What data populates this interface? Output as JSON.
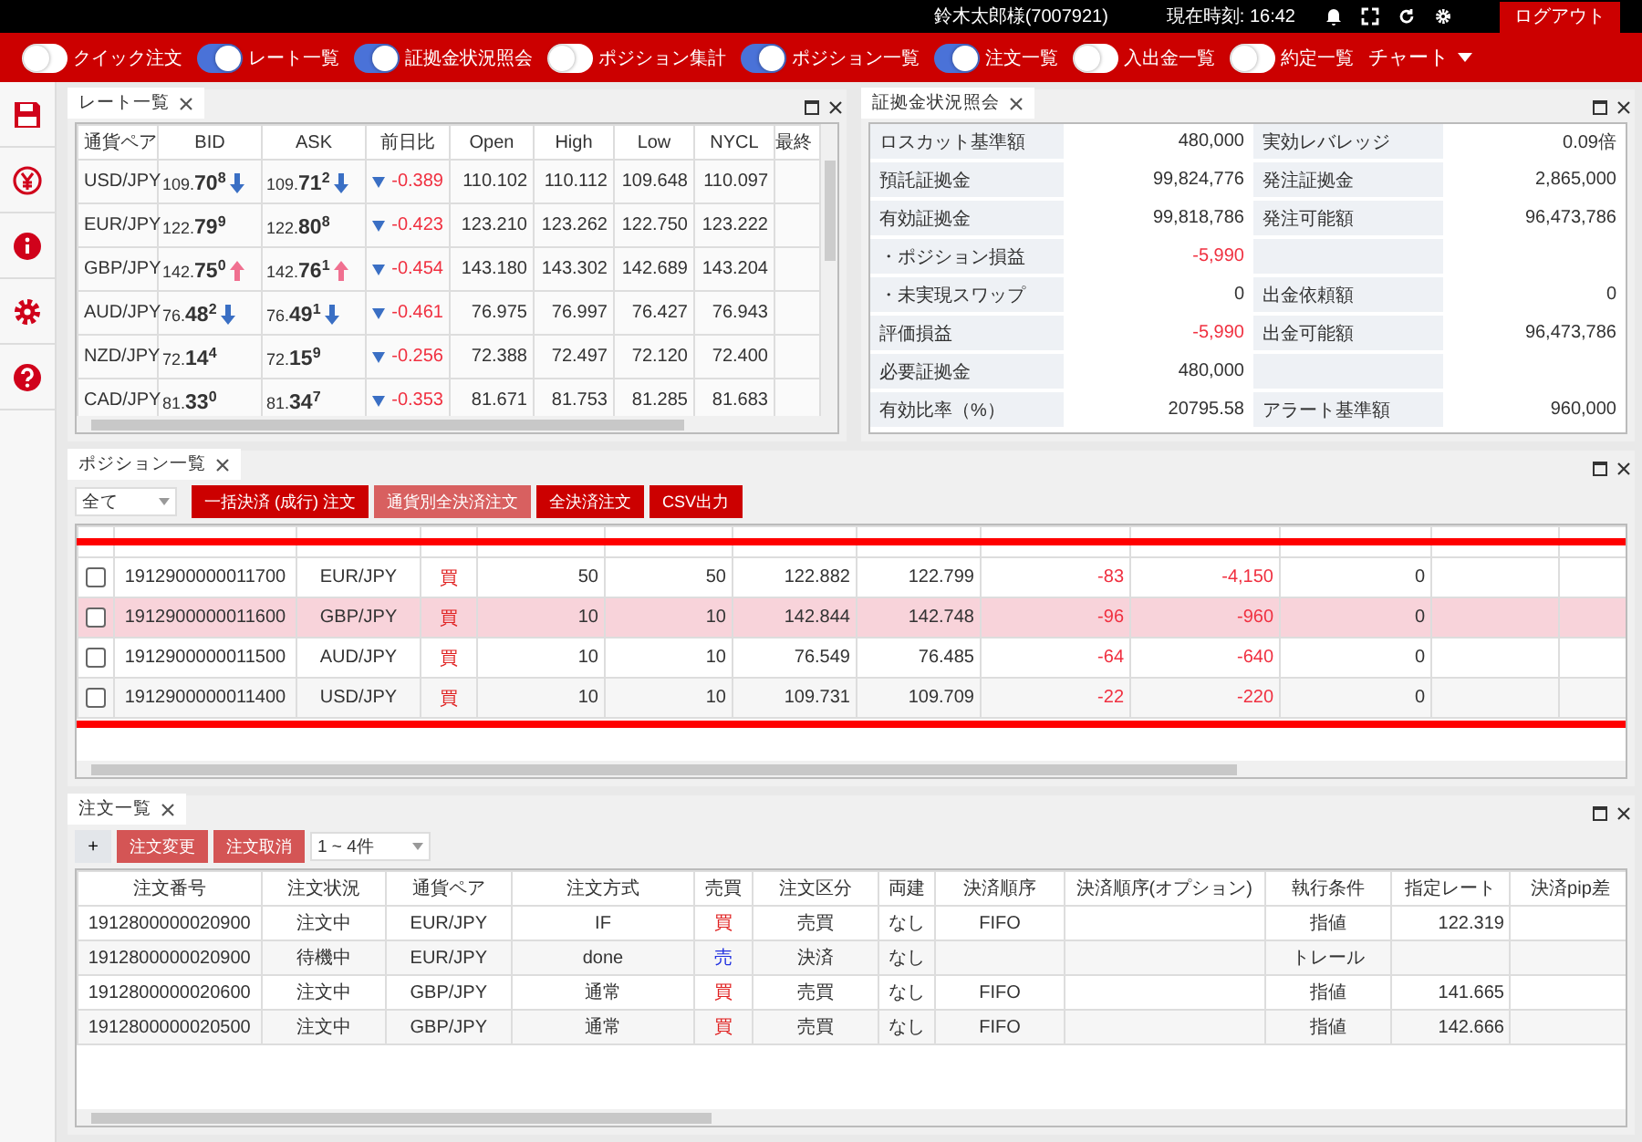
{
  "header": {
    "user": "鈴木太郎様(7007921)",
    "clock_label": "現在時刻:",
    "clock": "16:42",
    "logout": "ログアウト"
  },
  "toolbar": {
    "toggles": [
      {
        "label": "クイック注文",
        "on": false
      },
      {
        "label": "レート一覧",
        "on": true
      },
      {
        "label": "証拠金状況照会",
        "on": true
      },
      {
        "label": "ポジション集計",
        "on": false
      },
      {
        "label": "ポジション一覧",
        "on": true
      },
      {
        "label": "注文一覧",
        "on": true
      },
      {
        "label": "入出金一覧",
        "on": false
      },
      {
        "label": "約定一覧",
        "on": false
      }
    ],
    "chart_menu": "チャート"
  },
  "rate_panel": {
    "title": "レート一覧",
    "columns": [
      "通貨ペア",
      "BID",
      "ASK",
      "前日比",
      "Open",
      "High",
      "Low",
      "NYCL",
      "最終"
    ],
    "rows": [
      {
        "pair": "USD/JPY",
        "bid": "109.**70**$^{8}$",
        "bid_up": false,
        "bid_down": true,
        "ask": "109.**71**$^{2}$",
        "ask_up": false,
        "ask_down": true,
        "change_down": true,
        "change": "-0.389",
        "open": "110.102",
        "high": "110.112",
        "low": "109.648",
        "nycl": "110.097"
      },
      {
        "pair": "EUR/JPY",
        "bid": "122.**79**$^{9}$",
        "bid_up": false,
        "bid_down": false,
        "ask": "122.**80**$^{8}$",
        "ask_up": false,
        "ask_down": false,
        "change_down": true,
        "change": "-0.423",
        "open": "123.210",
        "high": "123.262",
        "low": "122.750",
        "nycl": "123.222"
      },
      {
        "pair": "GBP/JPY",
        "bid": "142.**75**$^{0}$",
        "bid_up": true,
        "bid_down": false,
        "ask": "142.**76**$^{1}$",
        "ask_up": true,
        "ask_down": false,
        "change_down": true,
        "change": "-0.454",
        "open": "143.180",
        "high": "143.302",
        "low": "142.689",
        "nycl": "143.204"
      },
      {
        "pair": "AUD/JPY",
        "bid": "76.**48**$^{2}$",
        "bid_up": false,
        "bid_down": true,
        "ask": "76.**49**$^{1}$",
        "ask_up": false,
        "ask_down": true,
        "change_down": true,
        "change": "-0.461",
        "open": "76.975",
        "high": "76.997",
        "low": "76.427",
        "nycl": "76.943"
      },
      {
        "pair": "NZD/JPY",
        "bid": "72.**14**$^{4}$",
        "bid_up": false,
        "bid_down": false,
        "ask": "72.**15**$^{9}$",
        "ask_up": false,
        "ask_down": false,
        "change_down": true,
        "change": "-0.256",
        "open": "72.388",
        "high": "72.497",
        "low": "72.120",
        "nycl": "72.400"
      },
      {
        "pair": "CAD/JPY",
        "bid": "81.**33**$^{0}$",
        "bid_up": false,
        "bid_down": false,
        "ask": "81.**34**$^{7}$",
        "ask_up": false,
        "ask_down": false,
        "change_down": true,
        "change": "-0.353",
        "open": "81.671",
        "high": "81.753",
        "low": "81.285",
        "nycl": "81.683"
      }
    ]
  },
  "margin_panel": {
    "title": "証拠金状況照会",
    "rows": [
      {
        "label": "ロスカット基準額",
        "value": "480,000",
        "negative": false,
        "label2": "実効レバレッジ",
        "value2": "0.09倍"
      },
      {
        "label": "預託証拠金",
        "value": "99,824,776",
        "negative": false,
        "label2": "発注証拠金",
        "value2": "2,865,000"
      },
      {
        "label": "有効証拠金",
        "value": "99,818,786",
        "negative": false,
        "label2": "発注可能額",
        "value2": "96,473,786"
      },
      {
        "label": "・ポジション損益",
        "value": "-5,990",
        "negative": true
      },
      {
        "label": "・未実現スワップ",
        "value": "0",
        "negative": false,
        "label2": "出金依頼額",
        "value2": "0"
      },
      {
        "label": "評価損益",
        "value": "-5,990",
        "negative": true,
        "label2": "出金可能額",
        "value2": "96,473,786"
      },
      {
        "label": "必要証拠金",
        "value": "480,000",
        "negative": false
      },
      {
        "label": "有効比率（%）",
        "value": "20795.58",
        "negative": false,
        "label2": "アラート基準額",
        "value2": "960,000"
      }
    ]
  },
  "position_panel": {
    "title": "ポジション一覧",
    "filter": "全て",
    "buttons": [
      {
        "label": "一括決済 (成行) 注文",
        "disabled": false
      },
      {
        "label": "通貨別全決済注文",
        "disabled": true
      },
      {
        "label": "全決済注文",
        "disabled": false
      },
      {
        "label": "CSV出力",
        "disabled": false
      }
    ],
    "rows": [
      {
        "checked": false,
        "selected": false,
        "id": "1912900000011700",
        "pair": "EUR/JPY",
        "side": "買",
        "qty": "50",
        "remaining": "50",
        "price": "122.882",
        "rate": "122.799",
        "pips": "-83",
        "pl": "-4,150",
        "swap": "0"
      },
      {
        "checked": false,
        "selected": true,
        "id": "1912900000011600",
        "pair": "GBP/JPY",
        "side": "買",
        "qty": "10",
        "remaining": "10",
        "price": "142.844",
        "rate": "142.748",
        "pips": "-96",
        "pl": "-960",
        "swap": "0"
      },
      {
        "checked": false,
        "selected": false,
        "id": "1912900000011500",
        "pair": "AUD/JPY",
        "side": "買",
        "qty": "10",
        "remaining": "10",
        "price": "76.549",
        "rate": "76.485",
        "pips": "-64",
        "pl": "-640",
        "swap": "0"
      },
      {
        "checked": false,
        "selected": false,
        "id": "1912900000011400",
        "pair": "USD/JPY",
        "side": "買",
        "qty": "10",
        "remaining": "10",
        "price": "109.731",
        "rate": "109.709",
        "pips": "-22",
        "pl": "-220",
        "swap": "0"
      }
    ]
  },
  "order_panel": {
    "title": "注文一覧",
    "add": "+",
    "buttons": [
      "注文変更",
      "注文取消"
    ],
    "range": "1 ~ 4件",
    "columns": [
      "注文番号",
      "注文状況",
      "通貨ペア",
      "注文方式",
      "売買",
      "注文区分",
      "両建",
      "決済順序",
      "決済順序(オプション)",
      "執行条件",
      "指定レート",
      "決済pip差"
    ],
    "rows": [
      {
        "id": "1912800000020900",
        "status": "注文中",
        "pair": "EUR/JPY",
        "method": "IF",
        "side": "買",
        "sell": false,
        "kbn": "売買",
        "hedge": "なし",
        "order": "FIFO",
        "condition": "指値",
        "rate": "122.319"
      },
      {
        "id": "1912800000020900",
        "status": "待機中",
        "pair": "EUR/JPY",
        "method": "done",
        "side": "売",
        "sell": true,
        "kbn": "決済",
        "hedge": "なし",
        "condition": "トレール"
      },
      {
        "id": "1912800000020600",
        "status": "注文中",
        "pair": "GBP/JPY",
        "method": "通常",
        "side": "買",
        "sell": false,
        "kbn": "売買",
        "hedge": "なし",
        "order": "FIFO",
        "condition": "指値",
        "rate": "141.665"
      },
      {
        "id": "1912800000020500",
        "status": "注文中",
        "pair": "GBP/JPY",
        "method": "通常",
        "side": "買",
        "sell": false,
        "kbn": "売買",
        "hedge": "なし",
        "order": "FIFO",
        "condition": "指値",
        "rate": "142.666"
      }
    ]
  }
}
